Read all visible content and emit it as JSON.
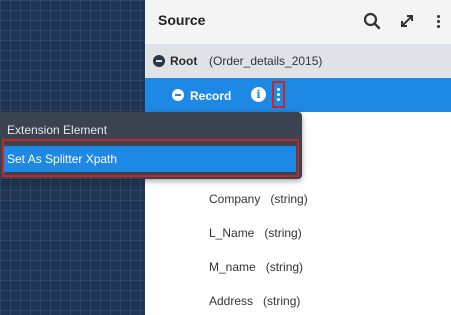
{
  "panel": {
    "title": "Source",
    "icons": [
      "search-icon",
      "expand-icon",
      "more-vertical-icon"
    ]
  },
  "root": {
    "label": "Root",
    "type": "(Order_details_2015)"
  },
  "record": {
    "label": "Record"
  },
  "fields": [
    {
      "name": "Company",
      "type": "(string)"
    },
    {
      "name": "L_Name",
      "type": "(string)"
    },
    {
      "name": "M_name",
      "type": "(string)"
    },
    {
      "name": "Address",
      "type": "(string)"
    }
  ],
  "context_menu": {
    "header": "Extension Element",
    "items": [
      {
        "label": "Set As Splitter Xpath",
        "selected": true
      }
    ]
  },
  "colors": {
    "accent": "#1e88e5",
    "highlight_border": "#c62828",
    "menu_bg": "#3b4350",
    "canvas_bg": "#1f3554"
  }
}
